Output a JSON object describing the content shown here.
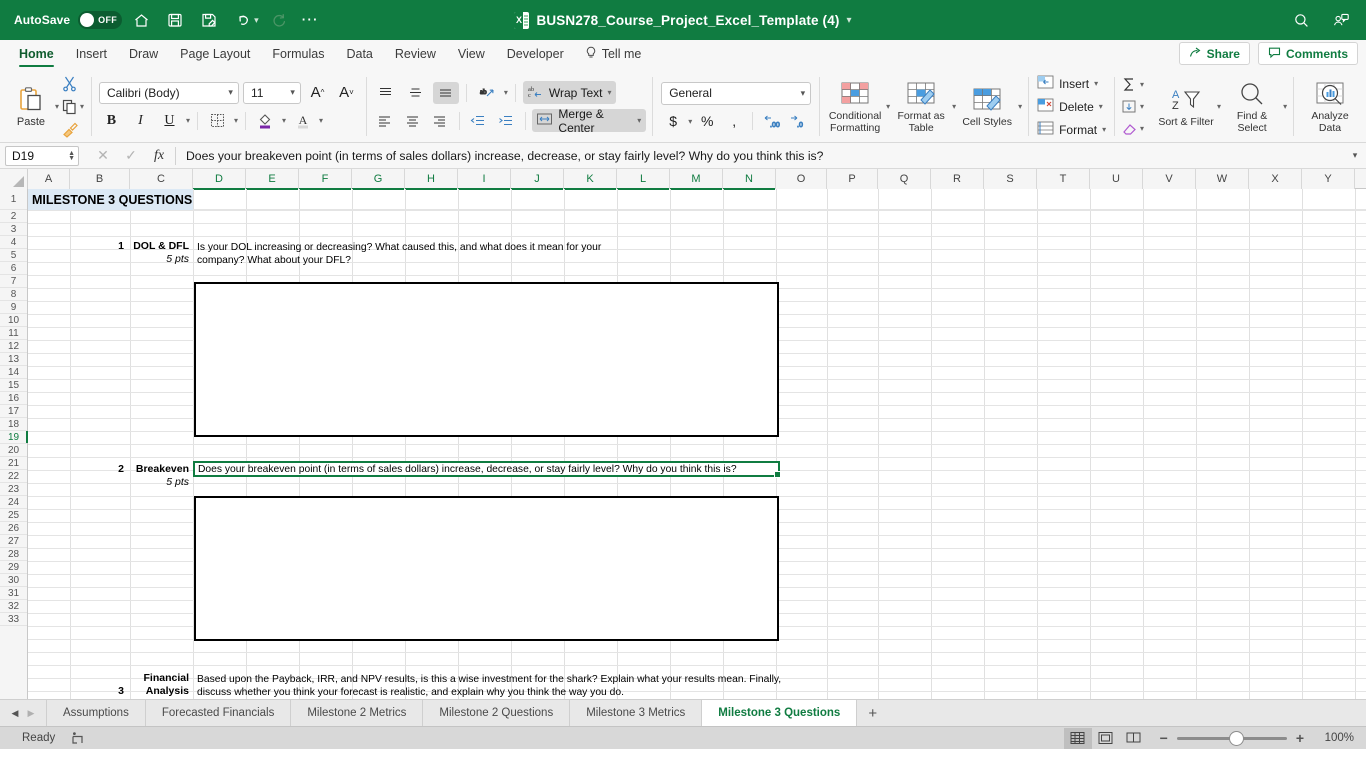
{
  "titlebar": {
    "autosave_label": "AutoSave",
    "autosave_state": "OFF",
    "document_title": "BUSN278_Course_Project_Excel_Template (4)",
    "icons": [
      "home-icon",
      "save-icon",
      "save-as-icon",
      "undo-icon",
      "redo-icon",
      "more-commands-icon"
    ],
    "right_icons": [
      "search-icon",
      "collaboration-icon"
    ]
  },
  "ribbon_tabs": {
    "items": [
      {
        "label": "Home",
        "active": true
      },
      {
        "label": "Insert",
        "active": false
      },
      {
        "label": "Draw",
        "active": false
      },
      {
        "label": "Page Layout",
        "active": false
      },
      {
        "label": "Formulas",
        "active": false
      },
      {
        "label": "Data",
        "active": false
      },
      {
        "label": "Review",
        "active": false
      },
      {
        "label": "View",
        "active": false
      },
      {
        "label": "Developer",
        "active": false
      }
    ],
    "tell_me": "Tell me",
    "share": "Share",
    "comments": "Comments"
  },
  "ribbon": {
    "paste_label": "Paste",
    "font_name": "Calibri (Body)",
    "font_size": "11",
    "wrap_text": "Wrap Text",
    "merge_center": "Merge & Center",
    "number_format": "General",
    "conditional_formatting": "Conditional Formatting",
    "format_as_table": "Format as Table",
    "cell_styles": "Cell Styles",
    "insert": "Insert",
    "delete": "Delete",
    "format": "Format",
    "sort_filter": "Sort & Filter",
    "find_select": "Find & Select",
    "analyze_data": "Analyze Data"
  },
  "formula_bar": {
    "name_box": "D19",
    "formula_text": "Does your breakeven point (in terms of sales dollars) increase, decrease, or stay fairly level?  Why do you think this is?"
  },
  "grid": {
    "columns": [
      "A",
      "B",
      "C",
      "D",
      "E",
      "F",
      "G",
      "H",
      "I",
      "J",
      "K",
      "L",
      "M",
      "N",
      "O",
      "P",
      "Q",
      "R",
      "S",
      "T",
      "U",
      "V",
      "W",
      "X",
      "Y"
    ],
    "selected_columns": [
      "D",
      "E",
      "F",
      "G",
      "H",
      "I",
      "J",
      "K",
      "L",
      "M",
      "N"
    ],
    "rows": [
      1,
      2,
      3,
      4,
      5,
      6,
      7,
      8,
      9,
      10,
      11,
      12,
      13,
      14,
      15,
      16,
      17,
      18,
      19,
      20,
      21,
      22,
      23,
      24,
      25,
      26,
      27,
      28,
      29,
      30,
      31,
      32,
      33
    ],
    "selected_row": 19,
    "cells": {
      "a1_title": "MILESTONE 3 QUESTIONS",
      "q1_number": "1",
      "q1_label": "DOL & DFL",
      "q1_points": "5 pts",
      "q1_text_line1": "Is your DOL increasing or decreasing?  What caused this, and what does it mean for your",
      "q1_text_line2": "company?  What about your DFL?",
      "q2_number": "2",
      "q2_label": "Breakeven",
      "q2_points": "5 pts",
      "q2_text": "Does your breakeven point (in terms of sales dollars) increase, decrease, or stay fairly level?  Why do you think this is?",
      "q3_number": "3",
      "q3_label_line1": "Financial",
      "q3_label_line2": "Analysis",
      "q3_text_line1": "Based upon the Payback, IRR, and NPV results, is this a wise investment for the shark?  Explain what your results mean.  Finally,",
      "q3_text_line2": "discuss whether you think your forecast is realistic, and explain why you think the way you do."
    }
  },
  "sheet_tabs": {
    "items": [
      {
        "label": "Assumptions",
        "active": false
      },
      {
        "label": "Forecasted Financials",
        "active": false
      },
      {
        "label": "Milestone 2 Metrics",
        "active": false
      },
      {
        "label": "Milestone 2 Questions",
        "active": false
      },
      {
        "label": "Milestone 3 Metrics",
        "active": false
      },
      {
        "label": "Milestone 3 Questions",
        "active": true
      }
    ],
    "add_sheet": "+"
  },
  "status_bar": {
    "status": "Ready",
    "zoom_level": "100%",
    "views": [
      "normal-view",
      "page-layout-view",
      "page-break-view"
    ]
  },
  "colors": {
    "brand_green": "#107c41",
    "title_fill": "#dce9f5",
    "selection_green": "#107c41"
  }
}
